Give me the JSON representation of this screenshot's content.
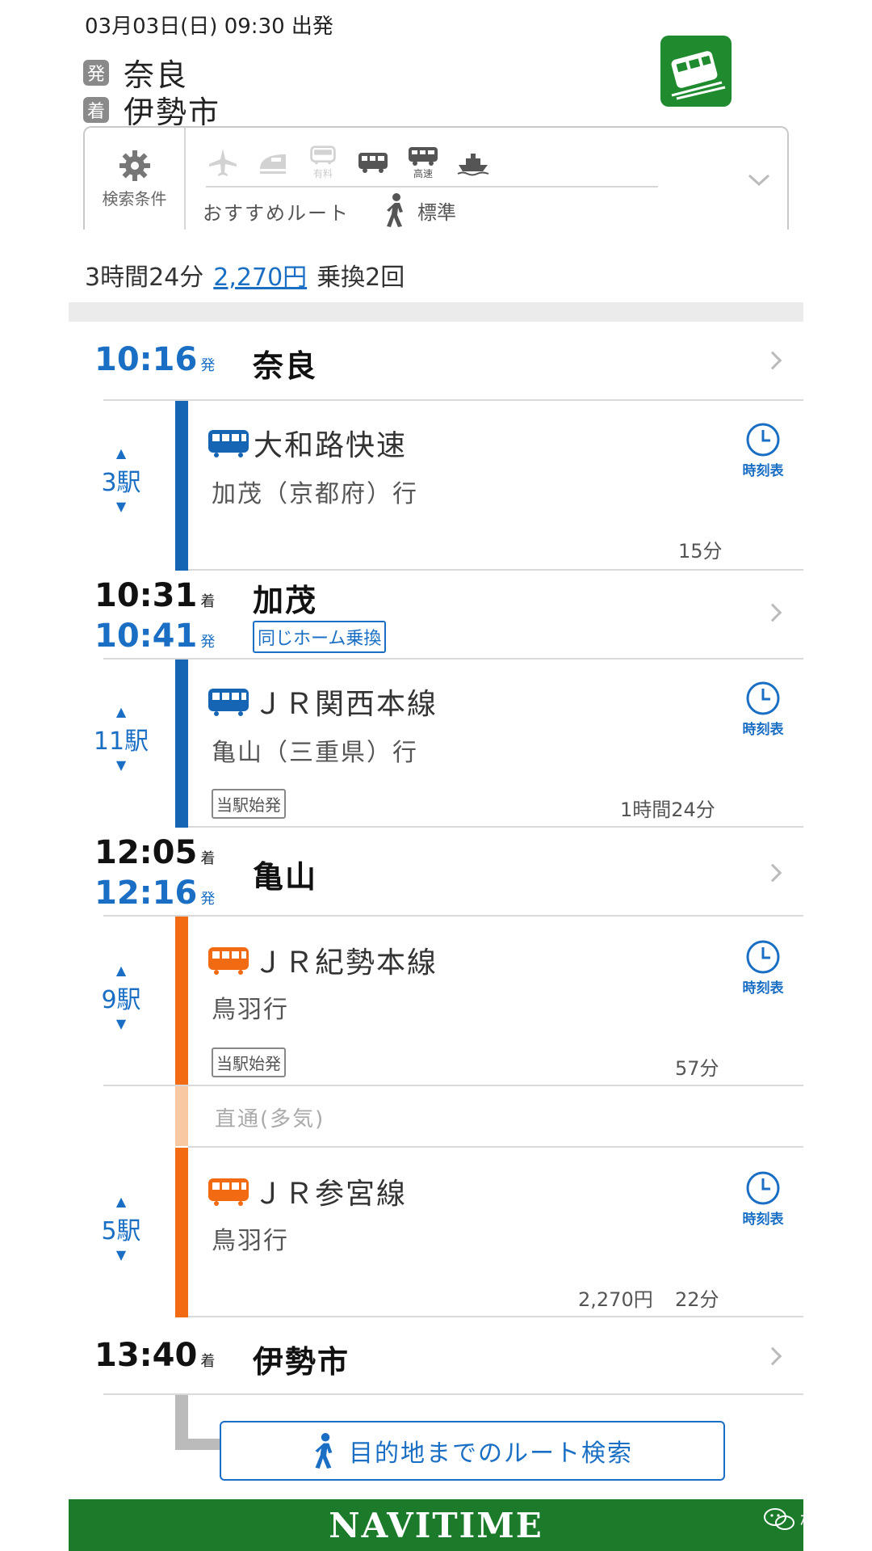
{
  "header": {
    "datetime": "03月03日(日) 09:30 出発",
    "from_badge": "発",
    "from": "奈良",
    "to_badge": "着",
    "to": "伊勢市"
  },
  "conditions": {
    "label": "検索条件",
    "modes": [
      {
        "name": "airplane",
        "sub": "",
        "active": false
      },
      {
        "name": "shinkansen",
        "sub": "",
        "active": false
      },
      {
        "name": "limited-express",
        "sub": "有料",
        "active": false
      },
      {
        "name": "bus",
        "sub": "",
        "active": true
      },
      {
        "name": "highway-bus",
        "sub": "高速",
        "active": true
      },
      {
        "name": "ferry",
        "sub": "",
        "active": true
      }
    ],
    "route_type": "おすすめルート",
    "walk_speed": "標準"
  },
  "summary": {
    "duration": "3時間24分",
    "fare": "2,270円",
    "transfers": "乗換2回"
  },
  "stations": [
    {
      "name": "奈良",
      "dep": "10:16",
      "dep_suffix": "発"
    },
    {
      "name": "加茂",
      "arr": "10:31",
      "arr_suffix": "着",
      "dep": "10:41",
      "dep_suffix": "発",
      "note": "同じホーム乗換"
    },
    {
      "name": "亀山",
      "arr": "12:05",
      "arr_suffix": "着",
      "dep": "12:16",
      "dep_suffix": "発"
    },
    {
      "name": "伊勢市",
      "arr": "13:40",
      "arr_suffix": "着"
    }
  ],
  "legs": [
    {
      "line": "大和路快速",
      "dest": "加茂（京都府）行",
      "stops": "3駅",
      "badge": "",
      "duration": "15分",
      "color": "#1665b5",
      "timetable": "時刻表"
    },
    {
      "line": "ＪＲ関西本線",
      "dest": "亀山（三重県）行",
      "stops": "11駅",
      "badge": "当駅始発",
      "duration": "1時間24分",
      "color": "#1665b5",
      "timetable": "時刻表"
    },
    {
      "line": "ＪＲ紀勢本線",
      "dest": "鳥羽行",
      "stops": "9駅",
      "badge": "当駅始発",
      "duration": "57分",
      "color": "#f26a12",
      "timetable": "時刻表"
    },
    {
      "line": "ＪＲ参宮線",
      "dest": "鳥羽行",
      "stops": "5駅",
      "badge": "",
      "duration": "22分",
      "fare": "2,270円",
      "color": "#f26a12",
      "timetable": "時刻表"
    }
  ],
  "through_service": "直通(多気)",
  "route_search_button": "目的地までのルート検索",
  "footer": {
    "logo": "NAVITIME"
  },
  "watermark": "桢叶"
}
